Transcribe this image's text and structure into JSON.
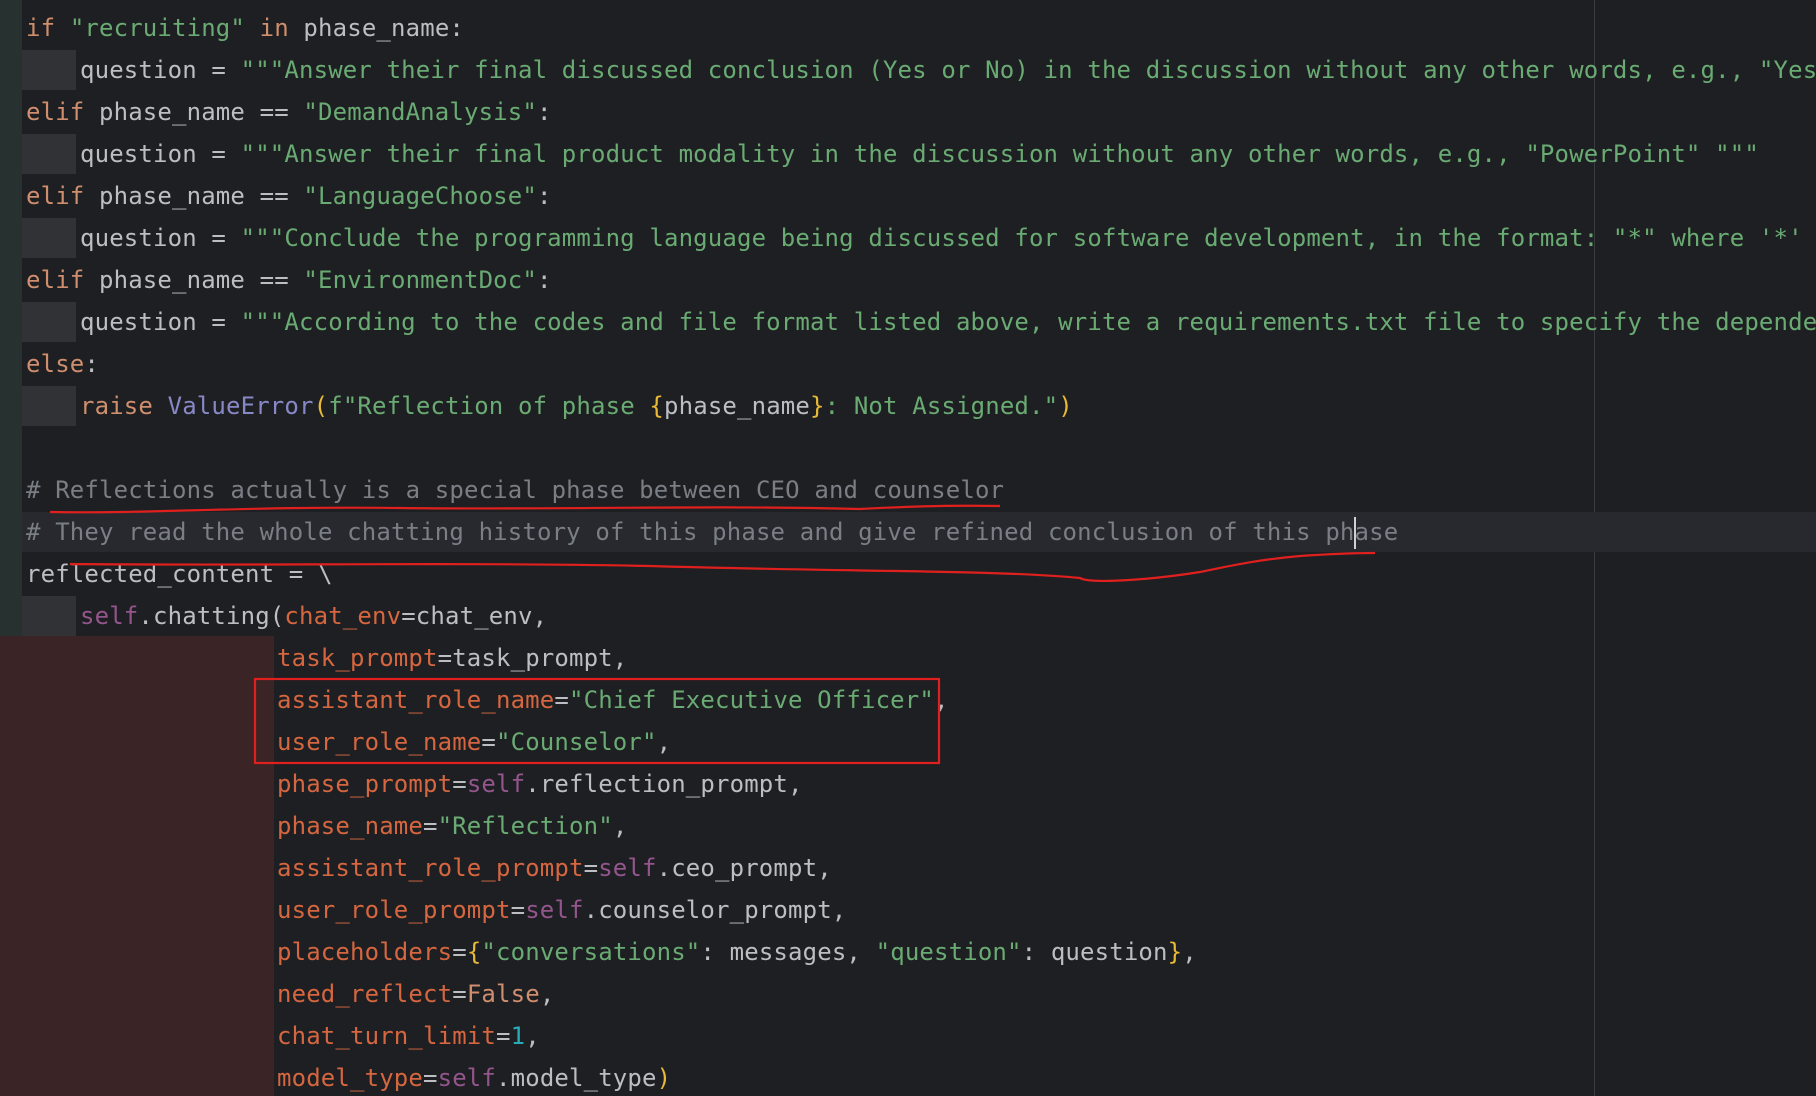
{
  "editor": {
    "lines": [
      {
        "indent": 0,
        "tokens": [
          {
            "t": "if ",
            "c": "kw"
          },
          {
            "t": "\"recruiting\"",
            "c": "str"
          },
          {
            "t": " in ",
            "c": "kw"
          },
          {
            "t": "phase_name:",
            "c": "plain"
          }
        ]
      },
      {
        "indent": 1,
        "tokens": [
          {
            "t": "question = ",
            "c": "plain"
          },
          {
            "t": "\"\"\"Answer their final discussed conclusion (Yes or No) in the discussion without any other words, e.g., \"Yes\" \"\"\"",
            "c": "str"
          }
        ]
      },
      {
        "indent": 0,
        "tokens": [
          {
            "t": "elif ",
            "c": "kw"
          },
          {
            "t": "phase_name == ",
            "c": "plain"
          },
          {
            "t": "\"DemandAnalysis\"",
            "c": "str"
          },
          {
            "t": ":",
            "c": "plain"
          }
        ]
      },
      {
        "indent": 1,
        "tokens": [
          {
            "t": "question = ",
            "c": "plain"
          },
          {
            "t": "\"\"\"Answer their final product modality in the discussion without any other words, e.g., \"PowerPoint\" \"\"\"",
            "c": "str"
          }
        ]
      },
      {
        "indent": 0,
        "tokens": [
          {
            "t": "elif ",
            "c": "kw"
          },
          {
            "t": "phase_name == ",
            "c": "plain"
          },
          {
            "t": "\"LanguageChoose\"",
            "c": "str"
          },
          {
            "t": ":",
            "c": "plain"
          }
        ]
      },
      {
        "indent": 1,
        "tokens": [
          {
            "t": "question = ",
            "c": "plain"
          },
          {
            "t": "\"\"\"Conclude the programming language being discussed for software development, in the format: \"*\" where '*' repre",
            "c": "str"
          }
        ]
      },
      {
        "indent": 0,
        "tokens": [
          {
            "t": "elif ",
            "c": "kw"
          },
          {
            "t": "phase_name == ",
            "c": "plain"
          },
          {
            "t": "\"EnvironmentDoc\"",
            "c": "str"
          },
          {
            "t": ":",
            "c": "plain"
          }
        ]
      },
      {
        "indent": 1,
        "tokens": [
          {
            "t": "question = ",
            "c": "plain"
          },
          {
            "t": "\"\"\"According to the codes and file format listed above, write a requirements.txt file to specify the dependencies",
            "c": "str"
          }
        ]
      },
      {
        "indent": 0,
        "tokens": [
          {
            "t": "else",
            "c": "kw"
          },
          {
            "t": ":",
            "c": "plain"
          }
        ]
      },
      {
        "indent": 1,
        "tokens": [
          {
            "t": "raise ",
            "c": "kw"
          },
          {
            "t": "ValueError",
            "c": "builtin"
          },
          {
            "t": "(",
            "c": "brace"
          },
          {
            "t": "f\"Reflection of phase ",
            "c": "str"
          },
          {
            "t": "{",
            "c": "brace"
          },
          {
            "t": "phase_name",
            "c": "plain"
          },
          {
            "t": "}",
            "c": "brace"
          },
          {
            "t": ": Not Assigned.\"",
            "c": "str"
          },
          {
            "t": ")",
            "c": "brace"
          }
        ]
      },
      {
        "indent": 0,
        "tokens": []
      },
      {
        "indent": 0,
        "tokens": [
          {
            "t": "# Reflections actually is a special phase between CEO and counselor",
            "c": "cmt"
          }
        ]
      },
      {
        "indent": 0,
        "tokens": [
          {
            "t": "# They read the whole chatting history of this phase and give refined conclusion of this ph",
            "c": "cmt"
          },
          {
            "t": "",
            "c": "caret"
          },
          {
            "t": "ase",
            "c": "cmt"
          }
        ]
      },
      {
        "indent": 0,
        "tokens": [
          {
            "t": "reflected_content = \\",
            "c": "plain"
          }
        ]
      },
      {
        "indent": 1,
        "tokens": [
          {
            "t": "self",
            "c": "self"
          },
          {
            "t": ".chatting(",
            "c": "plain"
          },
          {
            "t": "chat_env",
            "c": "param"
          },
          {
            "t": "=chat_env,",
            "c": "plain"
          }
        ]
      },
      {
        "indent": 2,
        "tokens": [
          {
            "t": "task_prompt",
            "c": "param"
          },
          {
            "t": "=task_prompt,",
            "c": "plain"
          }
        ]
      },
      {
        "indent": 2,
        "tokens": [
          {
            "t": "assistant_role_name",
            "c": "param"
          },
          {
            "t": "=",
            "c": "plain"
          },
          {
            "t": "\"Chief Executive Officer\"",
            "c": "str"
          },
          {
            "t": ",",
            "c": "plain"
          }
        ]
      },
      {
        "indent": 2,
        "tokens": [
          {
            "t": "user_role_name",
            "c": "param"
          },
          {
            "t": "=",
            "c": "plain"
          },
          {
            "t": "\"Counselor\"",
            "c": "str"
          },
          {
            "t": ",",
            "c": "plain"
          }
        ]
      },
      {
        "indent": 2,
        "tokens": [
          {
            "t": "phase_prompt",
            "c": "param"
          },
          {
            "t": "=",
            "c": "plain"
          },
          {
            "t": "self",
            "c": "self"
          },
          {
            "t": ".reflection_prompt,",
            "c": "plain"
          }
        ]
      },
      {
        "indent": 2,
        "tokens": [
          {
            "t": "phase_name",
            "c": "param"
          },
          {
            "t": "=",
            "c": "plain"
          },
          {
            "t": "\"Reflection\"",
            "c": "str"
          },
          {
            "t": ",",
            "c": "plain"
          }
        ]
      },
      {
        "indent": 2,
        "tokens": [
          {
            "t": "assistant_role_prompt",
            "c": "param"
          },
          {
            "t": "=",
            "c": "plain"
          },
          {
            "t": "self",
            "c": "self"
          },
          {
            "t": ".ceo_prompt,",
            "c": "plain"
          }
        ]
      },
      {
        "indent": 2,
        "tokens": [
          {
            "t": "user_role_prompt",
            "c": "param"
          },
          {
            "t": "=",
            "c": "plain"
          },
          {
            "t": "self",
            "c": "self"
          },
          {
            "t": ".counselor_prompt,",
            "c": "plain"
          }
        ]
      },
      {
        "indent": 2,
        "tokens": [
          {
            "t": "placeholders",
            "c": "param"
          },
          {
            "t": "=",
            "c": "plain"
          },
          {
            "t": "{",
            "c": "brace"
          },
          {
            "t": "\"conversations\"",
            "c": "str"
          },
          {
            "t": ": messages, ",
            "c": "plain"
          },
          {
            "t": "\"question\"",
            "c": "str"
          },
          {
            "t": ": question",
            "c": "plain"
          },
          {
            "t": "}",
            "c": "brace"
          },
          {
            "t": ",",
            "c": "plain"
          }
        ]
      },
      {
        "indent": 2,
        "tokens": [
          {
            "t": "need_reflect",
            "c": "param"
          },
          {
            "t": "=",
            "c": "plain"
          },
          {
            "t": "False",
            "c": "kw"
          },
          {
            "t": ",",
            "c": "plain"
          }
        ]
      },
      {
        "indent": 2,
        "tokens": [
          {
            "t": "chat_turn_limit",
            "c": "param"
          },
          {
            "t": "=",
            "c": "plain"
          },
          {
            "t": "1",
            "c": "num"
          },
          {
            "t": ",",
            "c": "plain"
          }
        ]
      },
      {
        "indent": 2,
        "tokens": [
          {
            "t": "model_type",
            "c": "param"
          },
          {
            "t": "=",
            "c": "plain"
          },
          {
            "t": "self",
            "c": "self"
          },
          {
            "t": ".model_type",
            "c": "plain"
          },
          {
            "t": ")",
            "c": "brace"
          }
        ]
      }
    ]
  },
  "colors": {
    "background": "#1e1f22",
    "keyword": "#cf8e6d",
    "string": "#6aab73",
    "comment": "#7a7e85",
    "parameter": "#d5663f",
    "self": "#94558d",
    "annotation_red": "#e0201e"
  }
}
